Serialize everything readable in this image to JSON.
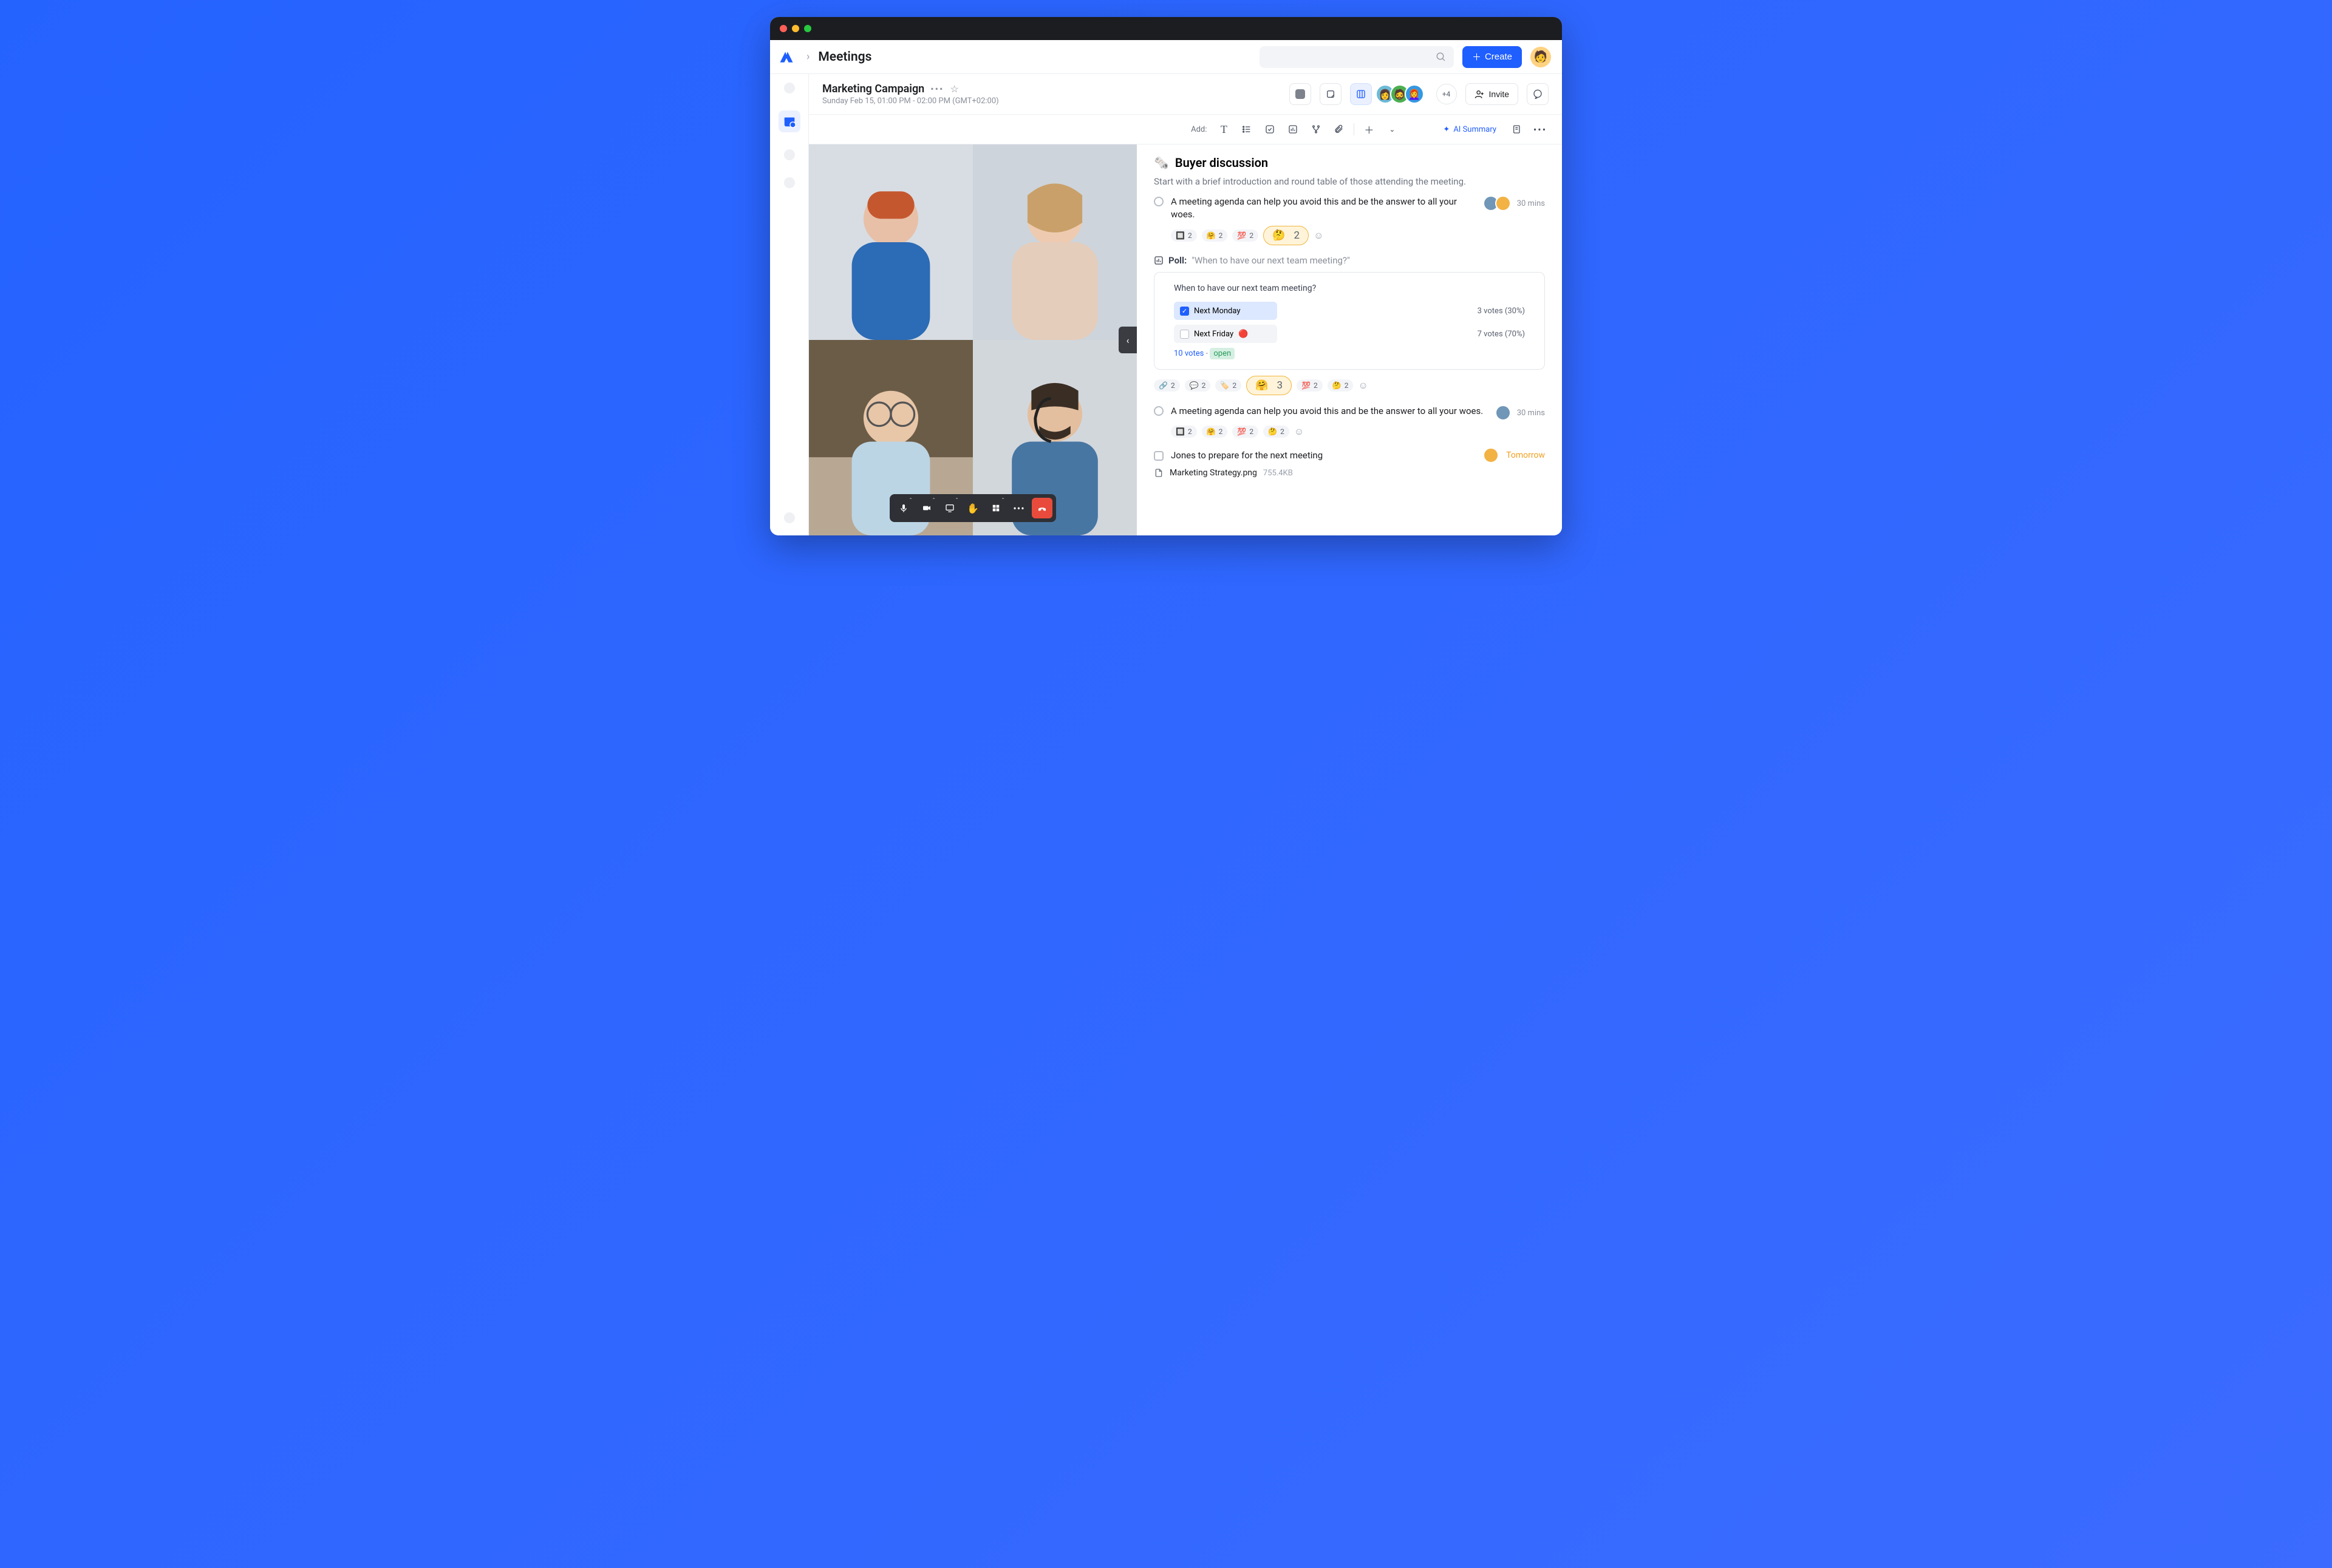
{
  "app": {
    "page_title": "Meetings"
  },
  "create_btn": "Create",
  "meeting": {
    "title": "Marketing Campaign",
    "subtitle": "Sunday Feb 15, 01:00 PM - 02:00 PM (GMT+02:00)",
    "more_attendees": "+4",
    "invite_label": "Invite"
  },
  "toolbar": {
    "add_label": "Add:",
    "ai_summary": "AI Summary"
  },
  "notes": {
    "section_title": "Buyer discussion",
    "intro": "Start with a brief introduction and round table of those attending the meeting.",
    "item1": {
      "text": "A meeting agenda can help you avoid this and be the answer to all your woes.",
      "duration": "30 mins"
    },
    "reactions1": {
      "r1_emoji": "🔲",
      "r1_count": "2",
      "r2_emoji": "🤗",
      "r2_count": "2",
      "r3_emoji": "💯",
      "r3_count": "2",
      "big_emoji": "🤔",
      "big_count": "2"
    },
    "poll": {
      "label": "Poll:",
      "question_inline": "\"When to have our next team meeting?\"",
      "question": "When to have our next team meeting?",
      "opt1": {
        "label": "Next Monday",
        "votes": "3 votes (30%)"
      },
      "opt2": {
        "label": "Next Friday",
        "votes": "7 votes (70%)"
      },
      "total": "10 votes",
      "sep": "-",
      "status": "open"
    },
    "reactions2": {
      "r1_emoji": "🔗",
      "r1_count": "2",
      "r2_emoji": "💬",
      "r2_count": "2",
      "r3_emoji": "🏷️",
      "r3_count": "2",
      "big_emoji": "🤗",
      "big_count": "3",
      "r4_emoji": "💯",
      "r4_count": "2",
      "r5_emoji": "🤔",
      "r5_count": "2"
    },
    "item2": {
      "text": "A meeting agenda can help you avoid this and be the answer to all your woes.",
      "duration": "30 mins"
    },
    "reactions3": {
      "r1_emoji": "🔲",
      "r1_count": "2",
      "r2_emoji": "🤗",
      "r2_count": "2",
      "r3_emoji": "💯",
      "r3_count": "2",
      "r4_emoji": "🤔",
      "r4_count": "2"
    },
    "task": {
      "text": "Jones to prepare for the next meeting",
      "due": "Tomorrow"
    },
    "file": {
      "name": "Marketing Strategy.png",
      "size": "755.4KB"
    }
  }
}
